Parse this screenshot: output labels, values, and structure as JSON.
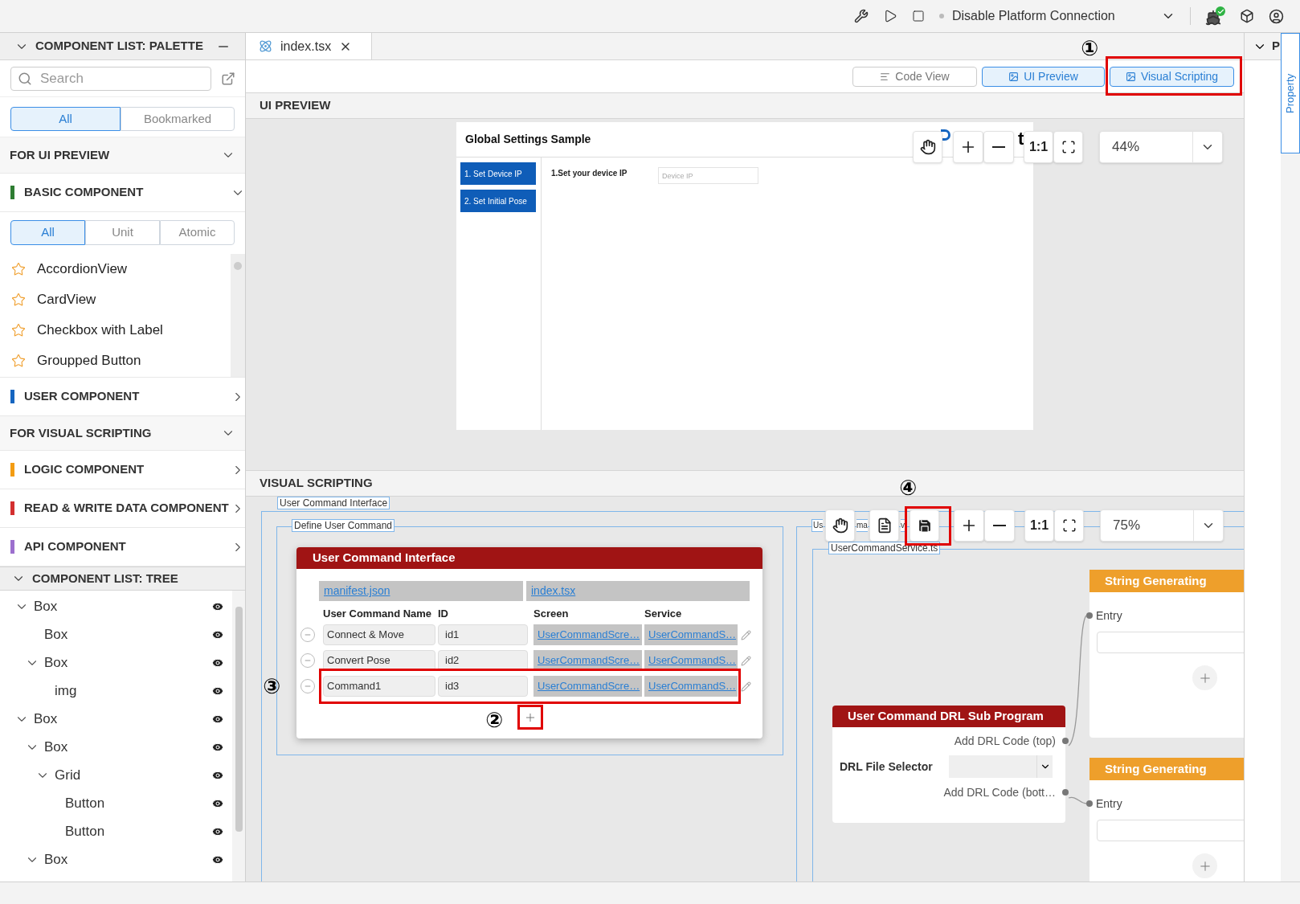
{
  "top_bar": {
    "connection_label": "Disable Platform Connection"
  },
  "palette": {
    "title": "COMPONENT LIST: PALETTE",
    "search": {
      "placeholder": "Search"
    },
    "filter_tabs": [
      {
        "label": "All",
        "selected": true
      },
      {
        "label": "Bookmarked",
        "selected": false
      }
    ],
    "groups": [
      {
        "kind": "heading",
        "label": "FOR UI PREVIEW",
        "expanded": true
      },
      {
        "kind": "category",
        "label": "BASIC COMPONENT",
        "color": "#2e7d32",
        "expanded": true,
        "subtabs": [
          {
            "label": "All",
            "selected": true
          },
          {
            "label": "Unit",
            "selected": false
          },
          {
            "label": "Atomic",
            "selected": false
          }
        ],
        "items": [
          {
            "label": "AccordionView",
            "bookmarked": false
          },
          {
            "label": "CardView",
            "bookmarked": false
          },
          {
            "label": "Checkbox with Label",
            "bookmarked": false
          },
          {
            "label": "Groupped Button",
            "bookmarked": false
          }
        ]
      },
      {
        "kind": "category",
        "label": "USER COMPONENT",
        "color": "#1565c0",
        "expanded": false
      },
      {
        "kind": "heading",
        "label": "FOR VISUAL SCRIPTING",
        "expanded": true
      },
      {
        "kind": "category",
        "label": "LOGIC COMPONENT",
        "color": "#f39c12",
        "expanded": false
      },
      {
        "kind": "category",
        "label": "READ & WRITE DATA COMPONENT",
        "color": "#d32f2f",
        "expanded": false
      },
      {
        "kind": "category",
        "label": "API COMPONENT",
        "color": "#9c6fce",
        "expanded": false
      }
    ]
  },
  "tree": {
    "title": "COMPONENT LIST: TREE",
    "nodes": [
      {
        "label": "Box",
        "expanded": true,
        "children": [
          {
            "label": "Box"
          },
          {
            "label": "Box",
            "expanded": true,
            "children": [
              {
                "label": "img"
              }
            ]
          }
        ]
      },
      {
        "label": "Box",
        "expanded": true,
        "children": [
          {
            "label": "Box",
            "expanded": true,
            "children": [
              {
                "label": "Grid",
                "expanded": true,
                "children": [
                  {
                    "label": "Button"
                  },
                  {
                    "label": "Button"
                  }
                ]
              }
            ]
          },
          {
            "label": "Box",
            "expanded": true
          }
        ]
      }
    ]
  },
  "editor": {
    "tab": {
      "label": "index.tsx"
    },
    "view_buttons": [
      {
        "kind": "code",
        "label": "Code View",
        "selected": false
      },
      {
        "kind": "preview",
        "label": "UI Preview",
        "selected": true
      },
      {
        "kind": "scripting",
        "label": "Visual Scripting",
        "selected": true,
        "annotation": "①"
      }
    ]
  },
  "ui_preview": {
    "title": "UI PREVIEW",
    "zoom": "44%",
    "zoom_label": "1:1",
    "preview": {
      "title": "Global Settings Sample",
      "nav": [
        "1. Set Device IP",
        "2. Set Initial Pose"
      ],
      "field_label": "1.Set your device IP",
      "field": {
        "placeholder": "Device IP"
      },
      "partial_text": "t"
    }
  },
  "visual_scripting": {
    "title": "VISUAL SCRIPTING",
    "zoom": "75%",
    "zoom_label": "1:1",
    "save_annotation": "④",
    "outer_group_label": "User Command Interface",
    "define_group_label": "Define User Command",
    "right_group_label_fragments": [
      "Us",
      "ma",
      "v"
    ],
    "service_group_label": "UserCommandService.ts",
    "command_card": {
      "title": "User Command Interface",
      "links": [
        "manifest.json",
        "index.tsx"
      ],
      "columns": [
        "User Command Name",
        "ID",
        "Screen",
        "Service"
      ],
      "rows": [
        {
          "name": "Connect & Move",
          "id": "id1",
          "screen": "UserCommandScre…",
          "service": "UserCommandS…"
        },
        {
          "name": "Convert Pose",
          "id": "id2",
          "screen": "UserCommandScre…",
          "service": "UserCommandS…"
        },
        {
          "name": "Command1",
          "id": "id3",
          "screen": "UserCommandScre…",
          "service": "UserCommandS…",
          "annotation": "③"
        }
      ],
      "add_annotation": "②"
    },
    "drl_card": {
      "title": "User Command DRL Sub Program",
      "outputs": [
        "Add DRL Code (top)",
        "Add DRL Code (bott…"
      ],
      "selector_label": "DRL File Selector"
    },
    "string_cards": [
      {
        "title": "String Generating",
        "input": "Entry"
      },
      {
        "title": "String Generating",
        "input": "Entry"
      }
    ]
  },
  "right_panel": {
    "header": "P",
    "tab": "Property"
  }
}
